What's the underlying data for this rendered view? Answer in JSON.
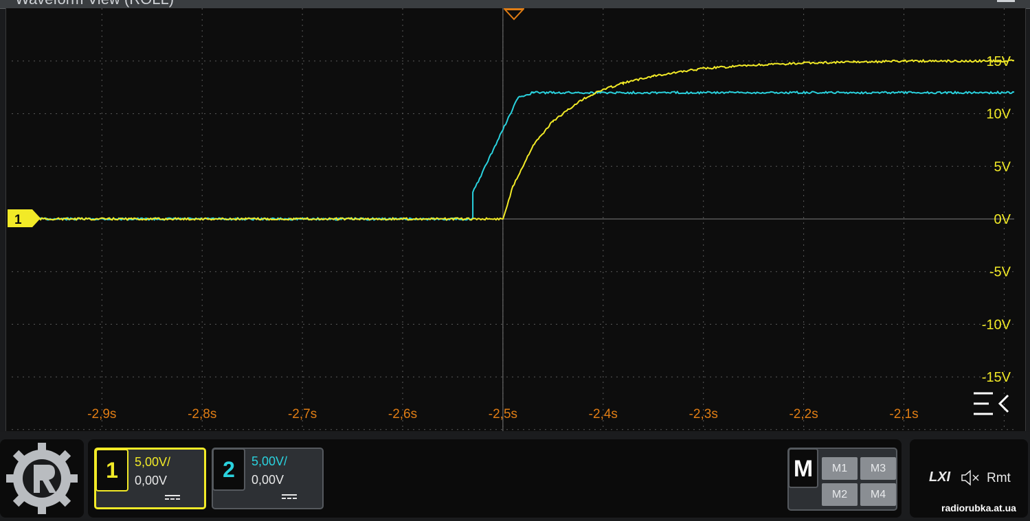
{
  "window": {
    "title": "Waveform View (ROLL)"
  },
  "chart_data": {
    "type": "line",
    "x_ticks": [
      "-2,9s",
      "-2,8s",
      "-2,7s",
      "-2,6s",
      "-2,5s",
      "-2,4s",
      "-2,3s",
      "-2,2s",
      "-2,1s"
    ],
    "y_ticks": [
      "15V",
      "10V",
      "5V",
      "0V",
      "-5V",
      "-10V",
      "-15V"
    ],
    "xlim": [
      -2.99,
      -1.99
    ],
    "ylim": [
      -20,
      20
    ],
    "grid": true,
    "series": [
      {
        "color": "#2ad2de",
        "x": [
          -2.99,
          -2.53,
          -2.53,
          -2.485,
          -2.47,
          -1.99
        ],
        "y": [
          0,
          0,
          2.5,
          11.5,
          12,
          12
        ]
      },
      {
        "color": "#f2ea27",
        "x": [
          -2.99,
          -2.5,
          -2.49,
          -2.47,
          -2.45,
          -2.42,
          -2.4,
          -2.38,
          -2.35,
          -2.3,
          -2.25,
          -2.2,
          -2.15,
          -2.1,
          -1.99
        ],
        "y": [
          0,
          0,
          3.1,
          7.0,
          9.3,
          11.4,
          12.3,
          12.9,
          13.6,
          14.3,
          14.6,
          14.8,
          14.9,
          15.0,
          15.0
        ]
      }
    ]
  },
  "markers": {
    "trigger_color": "#e07d14",
    "ch1_ground_label": "1"
  },
  "channels": [
    {
      "number": "1",
      "scale": "5,00V/",
      "offset": "0,00V",
      "color": "#f2ea27",
      "coupling_icon": "dc-coupling-icon"
    },
    {
      "number": "2",
      "scale": "5,00V/",
      "offset": "0,00V",
      "color": "#2ad2de",
      "coupling_icon": "dc-coupling-icon"
    }
  ],
  "math": {
    "label": "M",
    "buttons": [
      "M1",
      "M3",
      "M2",
      "M4"
    ]
  },
  "status": {
    "lxi": "LXI",
    "remote": "Rmt",
    "speaker_icon": "speaker-muted-icon"
  },
  "watermark": "radiorubka.at.ua"
}
